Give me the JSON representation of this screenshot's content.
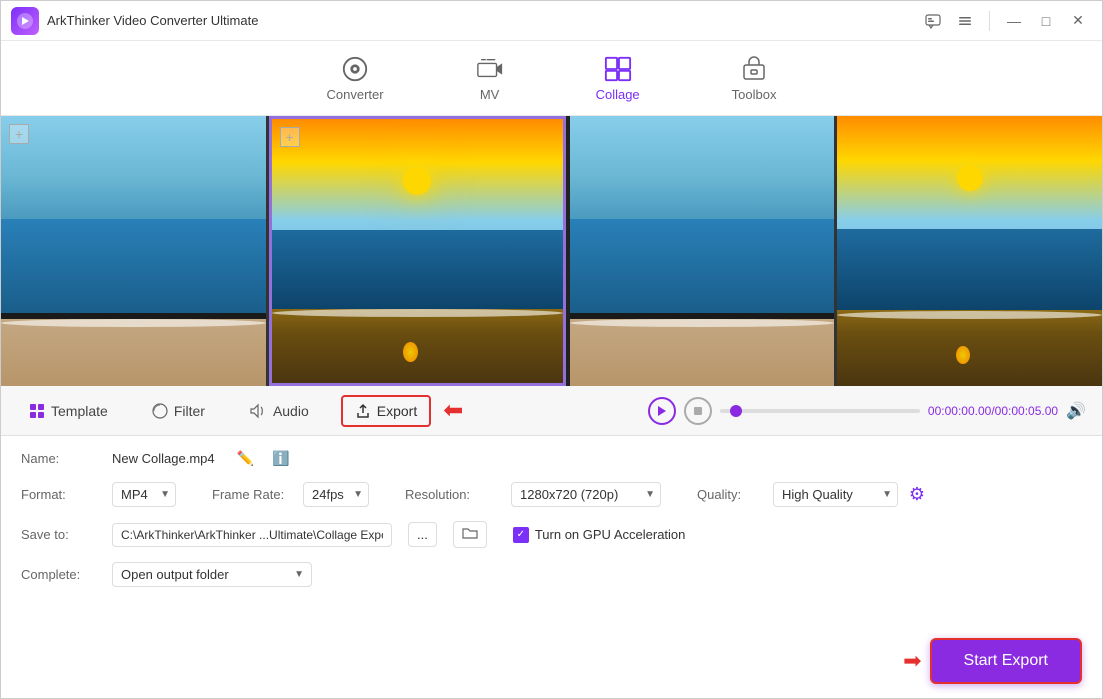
{
  "app": {
    "title": "ArkThinker Video Converter Ultimate",
    "icon": "🎬"
  },
  "titlebar": {
    "controls": {
      "chat_label": "💬",
      "minimize_label": "—",
      "maximize_label": "□",
      "close_label": "✕"
    }
  },
  "nav": {
    "tabs": [
      {
        "id": "converter",
        "label": "Converter",
        "active": false
      },
      {
        "id": "mv",
        "label": "MV",
        "active": false
      },
      {
        "id": "collage",
        "label": "Collage",
        "active": true
      },
      {
        "id": "toolbox",
        "label": "Toolbox",
        "active": false
      }
    ]
  },
  "toolbar": {
    "template_label": "Template",
    "filter_label": "Filter",
    "audio_label": "Audio",
    "export_label": "Export"
  },
  "playback": {
    "time_current": "00:00:00.00",
    "time_total": "00:00:05.00",
    "time_separator": "/"
  },
  "settings": {
    "name_label": "Name:",
    "name_value": "New Collage.mp4",
    "format_label": "Format:",
    "format_value": "MP4",
    "framerate_label": "Frame Rate:",
    "framerate_value": "24fps",
    "resolution_label": "Resolution:",
    "resolution_value": "1280x720 (720p)",
    "quality_label": "Quality:",
    "quality_value": "High Quality",
    "saveto_label": "Save to:",
    "saveto_value": "C:\\ArkThinker\\ArkThinker ...Ultimate\\Collage Exported",
    "gpu_label": "Turn on GPU Acceleration",
    "complete_label": "Complete:",
    "complete_value": "Open output folder"
  },
  "buttons": {
    "more": "...",
    "start_export": "Start Export"
  },
  "colors": {
    "accent": "#8a2be2",
    "red": "#e53030",
    "active_tab": "#7b2ff7"
  }
}
